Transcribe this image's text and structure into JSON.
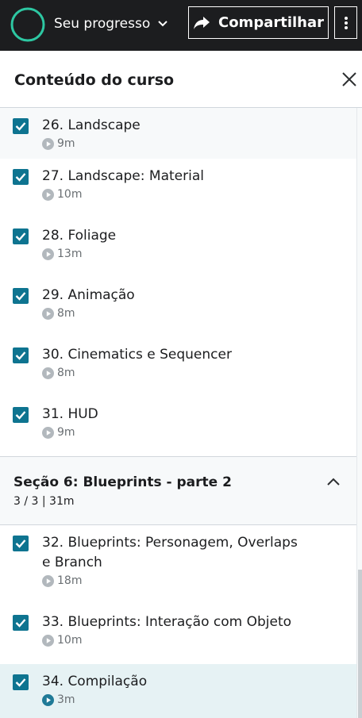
{
  "topbar": {
    "progress_label": "Seu progresso",
    "share_label": "Compartilhar",
    "progress_ring_color": "#2dc7a2"
  },
  "panel": {
    "title": "Conteúdo do curso"
  },
  "lectures_before": [
    {
      "title": "26. Landscape",
      "duration": "9m",
      "completed": true,
      "bg": "#f7f9fa"
    },
    {
      "title": "27. Landscape: Material",
      "duration": "10m",
      "completed": true,
      "bg": "#ffffff"
    },
    {
      "title": "28. Foliage",
      "duration": "13m",
      "completed": true,
      "bg": "#ffffff"
    },
    {
      "title": "29. Animação",
      "duration": "8m",
      "completed": true,
      "bg": "#ffffff"
    },
    {
      "title": "30. Cinematics e Sequencer",
      "duration": "8m",
      "completed": true,
      "bg": "#ffffff"
    },
    {
      "title": "31. HUD",
      "duration": "9m",
      "completed": true,
      "bg": "#ffffff"
    }
  ],
  "section": {
    "title": "Seção 6: Blueprints - parte 2",
    "meta": "3 / 3 | 31m"
  },
  "lectures_after": [
    {
      "title": "32. Blueprints: Personagem, Overlaps e Branch",
      "duration": "18m",
      "completed": true
    },
    {
      "title": "33. Blueprints: Interação com Objeto",
      "duration": "10m",
      "completed": true
    },
    {
      "title": "34. Compilação",
      "duration": "3m",
      "completed": true,
      "current": true
    }
  ],
  "colors": {
    "accent": "#0e7490",
    "current_bg": "#e6f2f4"
  }
}
